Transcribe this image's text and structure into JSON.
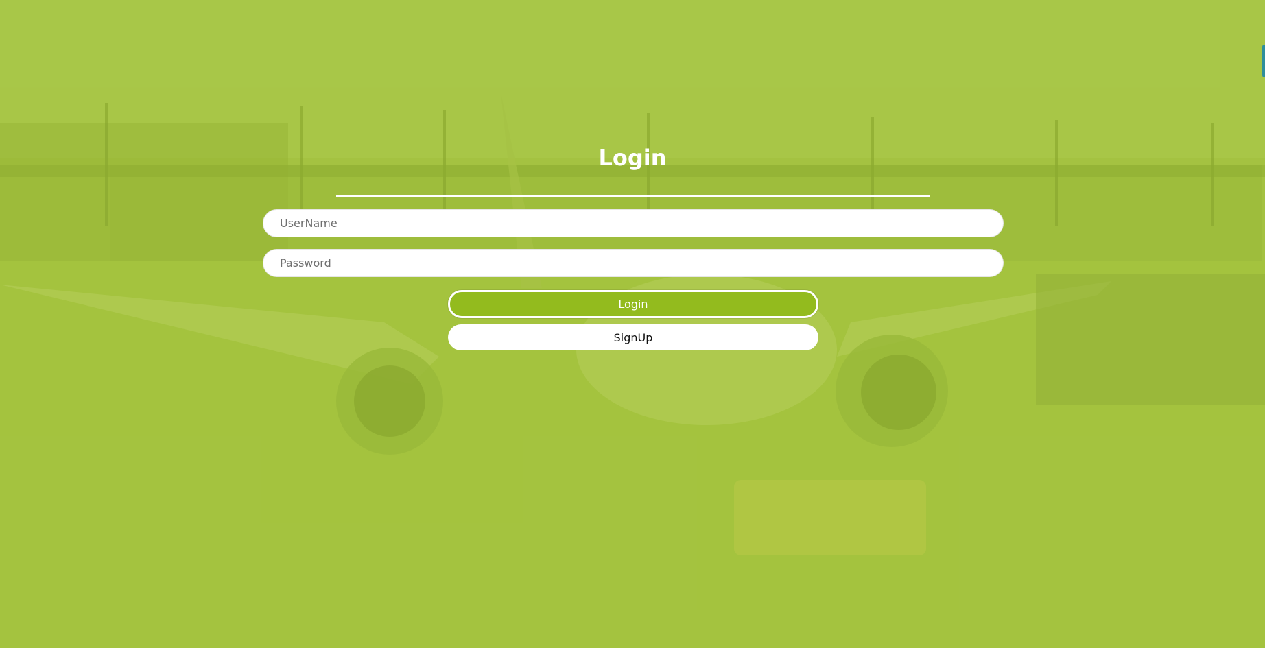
{
  "login": {
    "title": "Login",
    "username_placeholder": "UserName",
    "password_placeholder": "Password",
    "login_button": "Login",
    "signup_button": "SignUp"
  },
  "background": {
    "description_icon": "airport-apron-photo"
  },
  "colors": {
    "overlay": "#a3c244",
    "accent": "#93bb1e",
    "text_light": "#ffffff"
  }
}
